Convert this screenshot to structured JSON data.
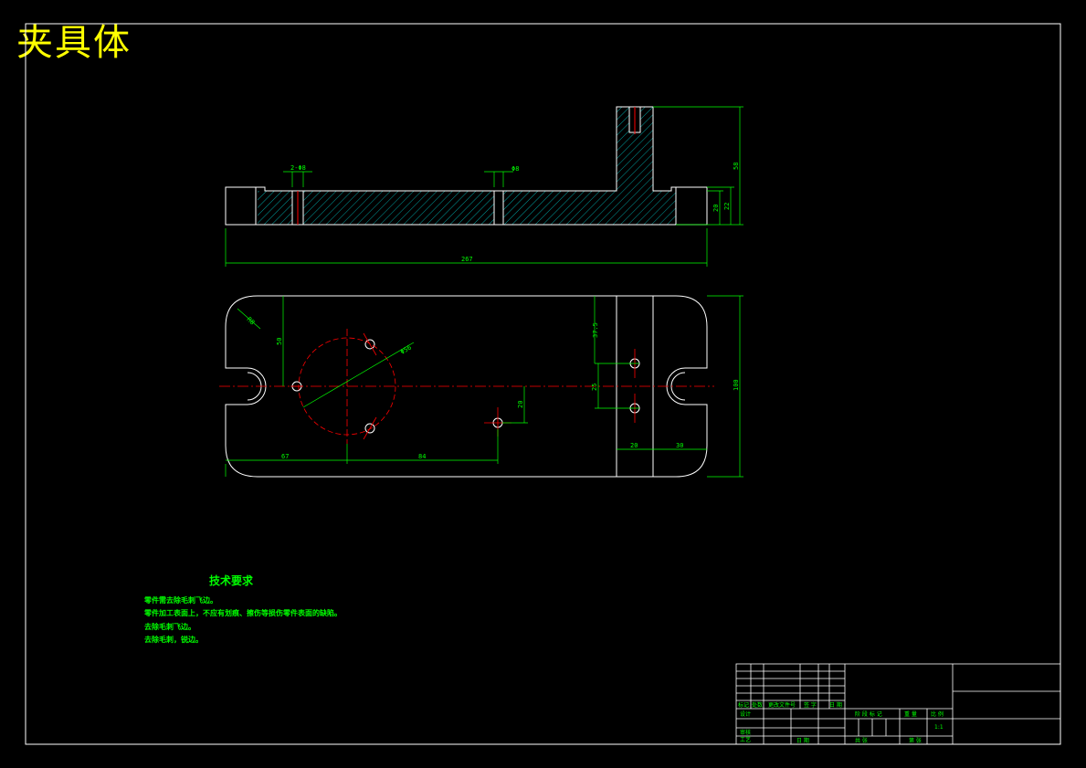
{
  "drawing": {
    "title": "夹具体",
    "colors": {
      "background": "#000000",
      "outline": "#ffffff",
      "dimension": "#00ff00",
      "centerline": "#ff0000",
      "hatch": "#00ffff",
      "title_text": "#ffff00"
    }
  },
  "tech_requirements": {
    "heading": "技术要求",
    "items": [
      "零件需去除毛刺飞边。",
      "零件加工表面上，不应有划痕、擦伤等损伤零件表面的缺陷。",
      "去除毛刺飞边。",
      "去除毛刺，锐边。"
    ]
  },
  "dimensions": {
    "front": {
      "hole1": "2-Φ8",
      "hole2": "Φ8",
      "height_total": "58",
      "height_base": "22",
      "height_step": "20",
      "length_total": "267"
    },
    "plan": {
      "corner_radius": "R8",
      "top_offset": "50",
      "circle": "Φ56",
      "offset_right_top": "37.5",
      "spacing": "25",
      "offset_low": "20",
      "length_left": "67",
      "length_mid": "84",
      "width_a": "20",
      "width_b": "30",
      "height_total": "100"
    }
  },
  "title_block": {
    "labels": [
      "标记",
      "处数",
      "更改文件号",
      "签 字",
      "日 期",
      "设计",
      "审核",
      "工艺",
      "日 期",
      "阶 段 标 记",
      "重 量",
      "比 例",
      "1:1",
      "共 张",
      "第 张"
    ]
  }
}
